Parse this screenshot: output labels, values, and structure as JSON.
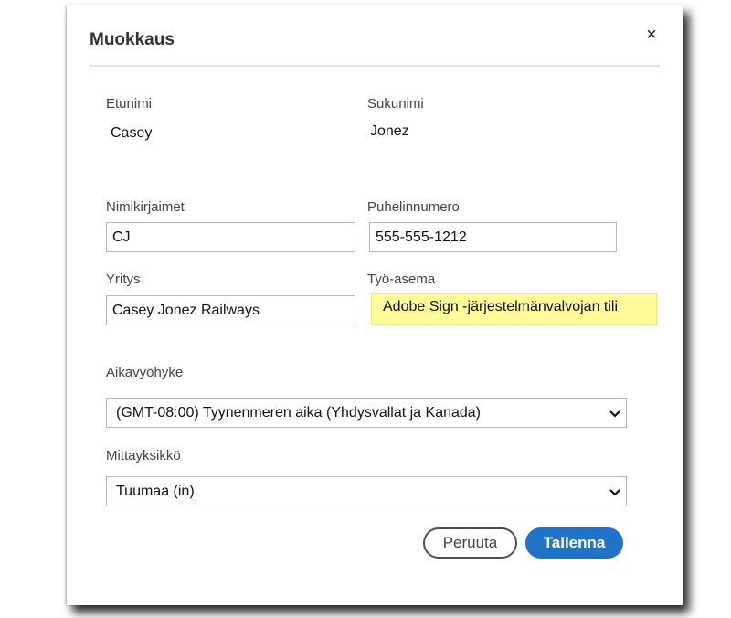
{
  "dialog": {
    "title": "Muokkaus",
    "close_glyph": "×"
  },
  "fields": {
    "first_name": {
      "label": "Etunimi",
      "value": "Casey"
    },
    "last_name": {
      "label": "Sukunimi",
      "value": "Jonez"
    },
    "initials": {
      "label": "Nimikirjaimet",
      "value": "CJ"
    },
    "phone": {
      "label": "Puhelinnumero",
      "value": "555-555-1212"
    },
    "company": {
      "label": "Yritys",
      "value": "Casey Jonez Railways"
    },
    "job_title": {
      "label": "Työ-asema",
      "value": "Adobe Sign -järjestelmänvalvojan tili"
    },
    "timezone": {
      "label": "Aikavyöhyke",
      "value": "(GMT-08:00) Tyynenmeren aika (Yhdysvallat ja Kanada)"
    },
    "units": {
      "label": "Mittayksikkö",
      "value": "Tuumaa (in)"
    }
  },
  "buttons": {
    "cancel": "Peruuta",
    "save": "Tallenna"
  },
  "colors": {
    "primary": "#1f74c8",
    "highlight": "#fdfb9a"
  },
  "icons": {
    "close": "close-icon",
    "dropdown": "chevron-down-icon"
  }
}
